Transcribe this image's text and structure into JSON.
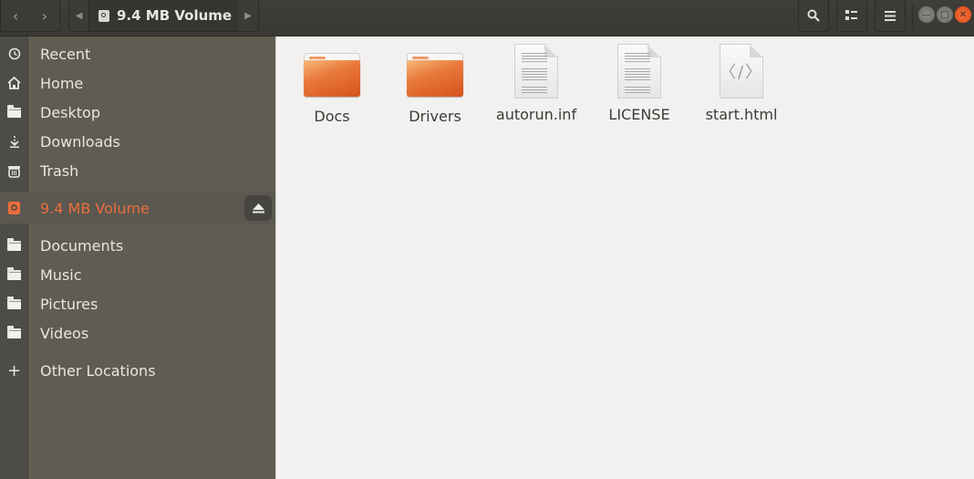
{
  "headerbar": {
    "back_icon": "chevron-left-icon",
    "forward_icon": "chevron-right-icon",
    "path_current": "9.4 MB Volume",
    "path_left_icon": "triangle-left-icon",
    "path_right_icon": "triangle-right-icon",
    "search_icon": "search-icon",
    "view_icon": "list-view-icon",
    "menu_icon": "hamburger-menu-icon",
    "window_controls": {
      "minimize": "—",
      "maximize": "□",
      "close": "✕"
    }
  },
  "sidebar": {
    "items": [
      {
        "label": "Recent",
        "icon": "clock-icon",
        "glyph": "◷"
      },
      {
        "label": "Home",
        "icon": "home-icon",
        "glyph": "⌂"
      },
      {
        "label": "Desktop",
        "icon": "folder-icon"
      },
      {
        "label": "Downloads",
        "icon": "download-icon",
        "glyph": "⇣"
      },
      {
        "label": "Trash",
        "icon": "trash-icon",
        "glyph": "🗑"
      },
      {
        "label": "9.4 MB Volume",
        "icon": "drive-icon",
        "active": true,
        "eject": "⏏"
      },
      {
        "label": "Documents",
        "icon": "folder-icon"
      },
      {
        "label": "Music",
        "icon": "folder-icon"
      },
      {
        "label": "Pictures",
        "icon": "folder-icon"
      },
      {
        "label": "Videos",
        "icon": "folder-icon"
      },
      {
        "label": "Other Locations",
        "icon": "plus-icon",
        "glyph": "+"
      }
    ]
  },
  "files": [
    {
      "name": "Docs",
      "type": "folder"
    },
    {
      "name": "Drivers",
      "type": "folder"
    },
    {
      "name": "autorun.inf",
      "type": "text"
    },
    {
      "name": "LICENSE",
      "type": "text"
    },
    {
      "name": "start.html",
      "type": "html",
      "glyph": "〈/〉"
    }
  ],
  "colors": {
    "accent": "#ec6d3c",
    "sidebar_bg": "#5f5c51",
    "content_bg": "#f2f1f0"
  }
}
